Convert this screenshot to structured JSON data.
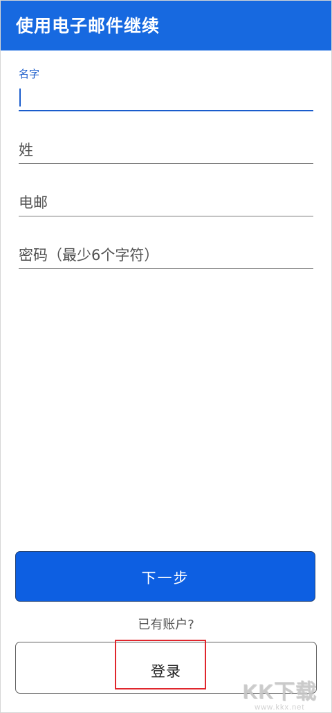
{
  "header": {
    "title": "使用电子邮件继续"
  },
  "form": {
    "first_name": {
      "label": "名字",
      "value": ""
    },
    "last_name": {
      "placeholder": "姓"
    },
    "email": {
      "placeholder": "电邮"
    },
    "password": {
      "placeholder": "密码（最少6个字符）"
    }
  },
  "actions": {
    "next_label": "下一步",
    "has_account_text": "已有账户?",
    "login_label": "登录"
  },
  "watermark": {
    "brand": "KK下载",
    "url": "www.kkx.net"
  },
  "colors": {
    "primary": "#1769e0",
    "button": "#0d5fe2",
    "highlight": "#e0262d"
  }
}
